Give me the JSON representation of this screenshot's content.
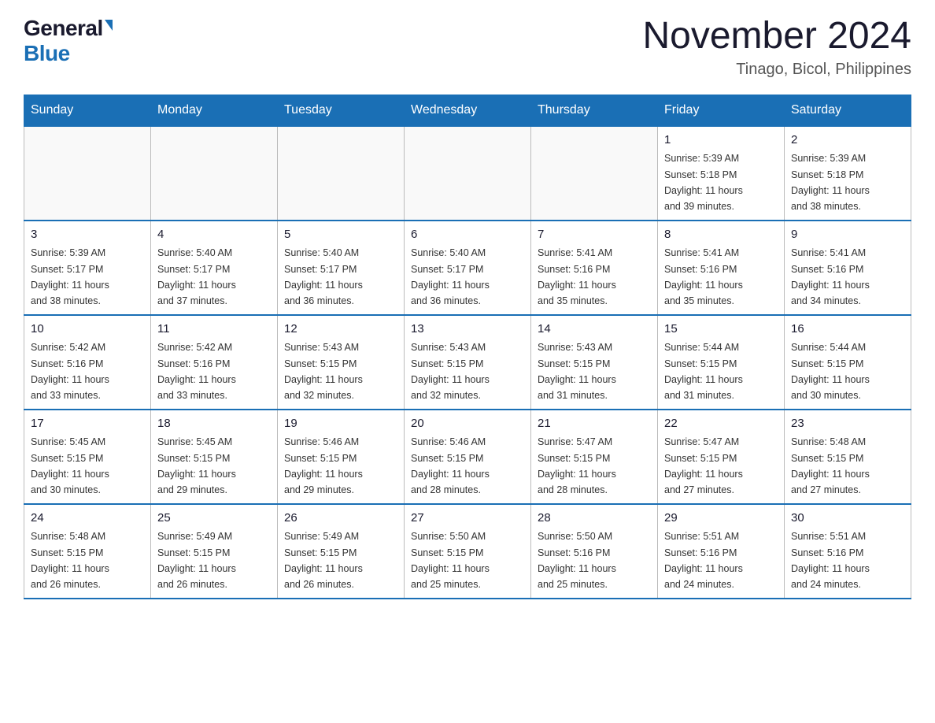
{
  "header": {
    "logo_general": "General",
    "logo_blue": "Blue",
    "month_title": "November 2024",
    "location": "Tinago, Bicol, Philippines"
  },
  "weekdays": [
    "Sunday",
    "Monday",
    "Tuesday",
    "Wednesday",
    "Thursday",
    "Friday",
    "Saturday"
  ],
  "weeks": [
    [
      {
        "day": "",
        "info": ""
      },
      {
        "day": "",
        "info": ""
      },
      {
        "day": "",
        "info": ""
      },
      {
        "day": "",
        "info": ""
      },
      {
        "day": "",
        "info": ""
      },
      {
        "day": "1",
        "info": "Sunrise: 5:39 AM\nSunset: 5:18 PM\nDaylight: 11 hours\nand 39 minutes."
      },
      {
        "day": "2",
        "info": "Sunrise: 5:39 AM\nSunset: 5:18 PM\nDaylight: 11 hours\nand 38 minutes."
      }
    ],
    [
      {
        "day": "3",
        "info": "Sunrise: 5:39 AM\nSunset: 5:17 PM\nDaylight: 11 hours\nand 38 minutes."
      },
      {
        "day": "4",
        "info": "Sunrise: 5:40 AM\nSunset: 5:17 PM\nDaylight: 11 hours\nand 37 minutes."
      },
      {
        "day": "5",
        "info": "Sunrise: 5:40 AM\nSunset: 5:17 PM\nDaylight: 11 hours\nand 36 minutes."
      },
      {
        "day": "6",
        "info": "Sunrise: 5:40 AM\nSunset: 5:17 PM\nDaylight: 11 hours\nand 36 minutes."
      },
      {
        "day": "7",
        "info": "Sunrise: 5:41 AM\nSunset: 5:16 PM\nDaylight: 11 hours\nand 35 minutes."
      },
      {
        "day": "8",
        "info": "Sunrise: 5:41 AM\nSunset: 5:16 PM\nDaylight: 11 hours\nand 35 minutes."
      },
      {
        "day": "9",
        "info": "Sunrise: 5:41 AM\nSunset: 5:16 PM\nDaylight: 11 hours\nand 34 minutes."
      }
    ],
    [
      {
        "day": "10",
        "info": "Sunrise: 5:42 AM\nSunset: 5:16 PM\nDaylight: 11 hours\nand 33 minutes."
      },
      {
        "day": "11",
        "info": "Sunrise: 5:42 AM\nSunset: 5:16 PM\nDaylight: 11 hours\nand 33 minutes."
      },
      {
        "day": "12",
        "info": "Sunrise: 5:43 AM\nSunset: 5:15 PM\nDaylight: 11 hours\nand 32 minutes."
      },
      {
        "day": "13",
        "info": "Sunrise: 5:43 AM\nSunset: 5:15 PM\nDaylight: 11 hours\nand 32 minutes."
      },
      {
        "day": "14",
        "info": "Sunrise: 5:43 AM\nSunset: 5:15 PM\nDaylight: 11 hours\nand 31 minutes."
      },
      {
        "day": "15",
        "info": "Sunrise: 5:44 AM\nSunset: 5:15 PM\nDaylight: 11 hours\nand 31 minutes."
      },
      {
        "day": "16",
        "info": "Sunrise: 5:44 AM\nSunset: 5:15 PM\nDaylight: 11 hours\nand 30 minutes."
      }
    ],
    [
      {
        "day": "17",
        "info": "Sunrise: 5:45 AM\nSunset: 5:15 PM\nDaylight: 11 hours\nand 30 minutes."
      },
      {
        "day": "18",
        "info": "Sunrise: 5:45 AM\nSunset: 5:15 PM\nDaylight: 11 hours\nand 29 minutes."
      },
      {
        "day": "19",
        "info": "Sunrise: 5:46 AM\nSunset: 5:15 PM\nDaylight: 11 hours\nand 29 minutes."
      },
      {
        "day": "20",
        "info": "Sunrise: 5:46 AM\nSunset: 5:15 PM\nDaylight: 11 hours\nand 28 minutes."
      },
      {
        "day": "21",
        "info": "Sunrise: 5:47 AM\nSunset: 5:15 PM\nDaylight: 11 hours\nand 28 minutes."
      },
      {
        "day": "22",
        "info": "Sunrise: 5:47 AM\nSunset: 5:15 PM\nDaylight: 11 hours\nand 27 minutes."
      },
      {
        "day": "23",
        "info": "Sunrise: 5:48 AM\nSunset: 5:15 PM\nDaylight: 11 hours\nand 27 minutes."
      }
    ],
    [
      {
        "day": "24",
        "info": "Sunrise: 5:48 AM\nSunset: 5:15 PM\nDaylight: 11 hours\nand 26 minutes."
      },
      {
        "day": "25",
        "info": "Sunrise: 5:49 AM\nSunset: 5:15 PM\nDaylight: 11 hours\nand 26 minutes."
      },
      {
        "day": "26",
        "info": "Sunrise: 5:49 AM\nSunset: 5:15 PM\nDaylight: 11 hours\nand 26 minutes."
      },
      {
        "day": "27",
        "info": "Sunrise: 5:50 AM\nSunset: 5:15 PM\nDaylight: 11 hours\nand 25 minutes."
      },
      {
        "day": "28",
        "info": "Sunrise: 5:50 AM\nSunset: 5:16 PM\nDaylight: 11 hours\nand 25 minutes."
      },
      {
        "day": "29",
        "info": "Sunrise: 5:51 AM\nSunset: 5:16 PM\nDaylight: 11 hours\nand 24 minutes."
      },
      {
        "day": "30",
        "info": "Sunrise: 5:51 AM\nSunset: 5:16 PM\nDaylight: 11 hours\nand 24 minutes."
      }
    ]
  ]
}
